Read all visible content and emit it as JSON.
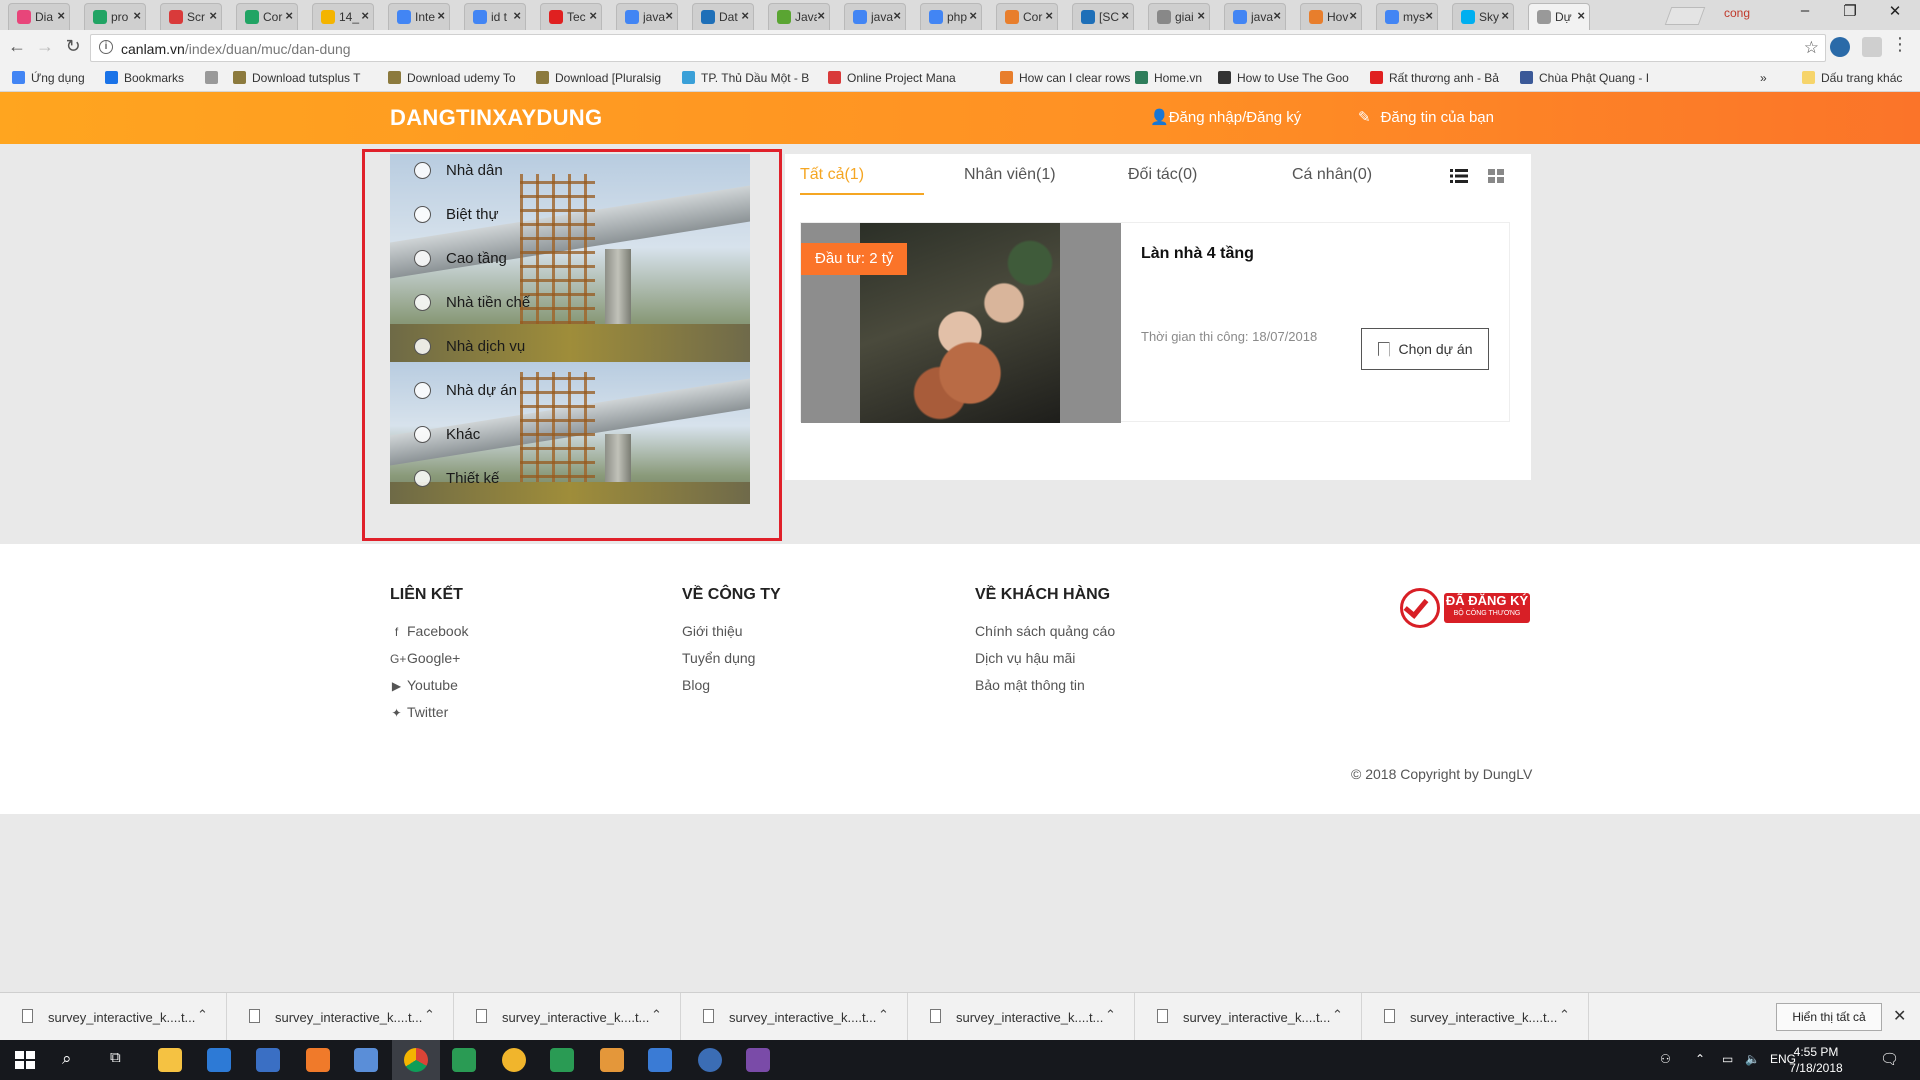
{
  "browser": {
    "tabs": [
      {
        "label": "Dia",
        "color": "#e8457a"
      },
      {
        "label": "pro",
        "color": "#21a464"
      },
      {
        "label": "Scr",
        "color": "#d93a3a"
      },
      {
        "label": "Cor",
        "color": "#21a464"
      },
      {
        "label": "14_",
        "color": "#f4b400"
      },
      {
        "label": "Inte",
        "color": "#4285f4"
      },
      {
        "label": "id t",
        "color": "#4285f4"
      },
      {
        "label": "Tec",
        "color": "#e02020"
      },
      {
        "label": "java",
        "color": "#4285f4"
      },
      {
        "label": "Dat",
        "color": "#1e6fb8"
      },
      {
        "label": "Java",
        "color": "#5aa532"
      },
      {
        "label": "java",
        "color": "#4285f4"
      },
      {
        "label": "php",
        "color": "#4285f4"
      },
      {
        "label": "Cor",
        "color": "#e87e2c"
      },
      {
        "label": "[SC",
        "color": "#1e6fb8"
      },
      {
        "label": "giai",
        "color": "#888888"
      },
      {
        "label": "java",
        "color": "#4285f4"
      },
      {
        "label": "Hov",
        "color": "#e87e2c"
      },
      {
        "label": "mys",
        "color": "#4285f4"
      },
      {
        "label": "Sky",
        "color": "#00aff0"
      },
      {
        "label": "Dự",
        "color": "#999999"
      }
    ],
    "user_badge": "cong",
    "url_host": "canlam.vn",
    "url_path": "/index/duan/muc/dan-dung",
    "bookmarks": [
      {
        "label": "Ứng dụng",
        "color": "#4285f4"
      },
      {
        "label": "Bookmarks",
        "color": "#1a73e8"
      },
      {
        "label": "",
        "color": "#999999"
      },
      {
        "label": "Download tutsplus T",
        "color": "#8c7a3d"
      },
      {
        "label": "Download udemy To",
        "color": "#8c7a3d"
      },
      {
        "label": "Download [Pluralsig",
        "color": "#8c7a3d"
      },
      {
        "label": "TP. Thủ Dầu Một - B",
        "color": "#3aa0d8"
      },
      {
        "label": "Online Project Mana",
        "color": "#d93a3a"
      },
      {
        "label": "How can I clear rows",
        "color": "#e87e2c"
      },
      {
        "label": "Home.vn",
        "color": "#2e7d5b"
      },
      {
        "label": "How to Use The Goo",
        "color": "#333333"
      },
      {
        "label": "Rất thương anh - Bả",
        "color": "#e02020"
      },
      {
        "label": "Chùa Phật Quang - I",
        "color": "#3b5998"
      }
    ],
    "bookmarks_more": "»",
    "bookmarks_other": "Dấu trang khác"
  },
  "site": {
    "brand": "DANGTINXAYDUNG",
    "login_label": "Đăng nhập/Đăng ký",
    "post_label": "Đăng tin của bạn"
  },
  "filter": {
    "options": [
      "Nhà dân",
      "Biệt thự",
      "Cao tầng",
      "Nhà tiền chế",
      "Nhà dịch vụ",
      "Nhà dự án",
      "Khác",
      "Thiết kế"
    ]
  },
  "results": {
    "tabs": [
      {
        "label": "Tất cả(1)",
        "active": true
      },
      {
        "label": "Nhân viên(1)",
        "active": false
      },
      {
        "label": "Đối tác(0)",
        "active": false
      },
      {
        "label": "Cá nhân(0)",
        "active": false
      }
    ],
    "card": {
      "badge": "Đầu tư: 2 tỷ",
      "title": "Làn nhà 4 tầng",
      "date": "Thời gian thi công: 18/07/2018",
      "button": "Chọn dự án"
    }
  },
  "footer": {
    "col1": {
      "title": "LIÊN KẾT",
      "links": [
        {
          "icon": "f",
          "label": "Facebook"
        },
        {
          "icon": "G+",
          "label": "Google+"
        },
        {
          "icon": "▶",
          "label": "Youtube"
        },
        {
          "icon": "✦",
          "label": "Twitter"
        }
      ]
    },
    "col2": {
      "title": "VỀ CÔNG TY",
      "links": [
        "Giới thiệu",
        "Tuyển dụng",
        "Blog"
      ]
    },
    "col3": {
      "title": "VỀ KHÁCH HÀNG",
      "links": [
        "Chính sách quảng cáo",
        "Dịch vụ hậu mãi",
        "Bảo mật thông tin"
      ]
    },
    "registered_line1": "ĐÃ ĐĂNG KÝ",
    "registered_line2": "BỘ CÔNG THƯƠNG",
    "copyright": "© 2018 Copyright by DungLV"
  },
  "downloads": {
    "items": [
      "survey_interactive_k....t...",
      "survey_interactive_k....t...",
      "survey_interactive_k....t...",
      "survey_interactive_k....t...",
      "survey_interactive_k....t...",
      "survey_interactive_k....t...",
      "survey_interactive_k....t..."
    ],
    "show_all": "Hiển thị tất cả"
  },
  "taskbar": {
    "lang": "ENG",
    "time": "4:55 PM",
    "date": "7/18/2018"
  },
  "colors": {
    "brand_orange": "#fb7429",
    "active_tab": "#f5a623",
    "highlight_red": "#e0202a"
  }
}
